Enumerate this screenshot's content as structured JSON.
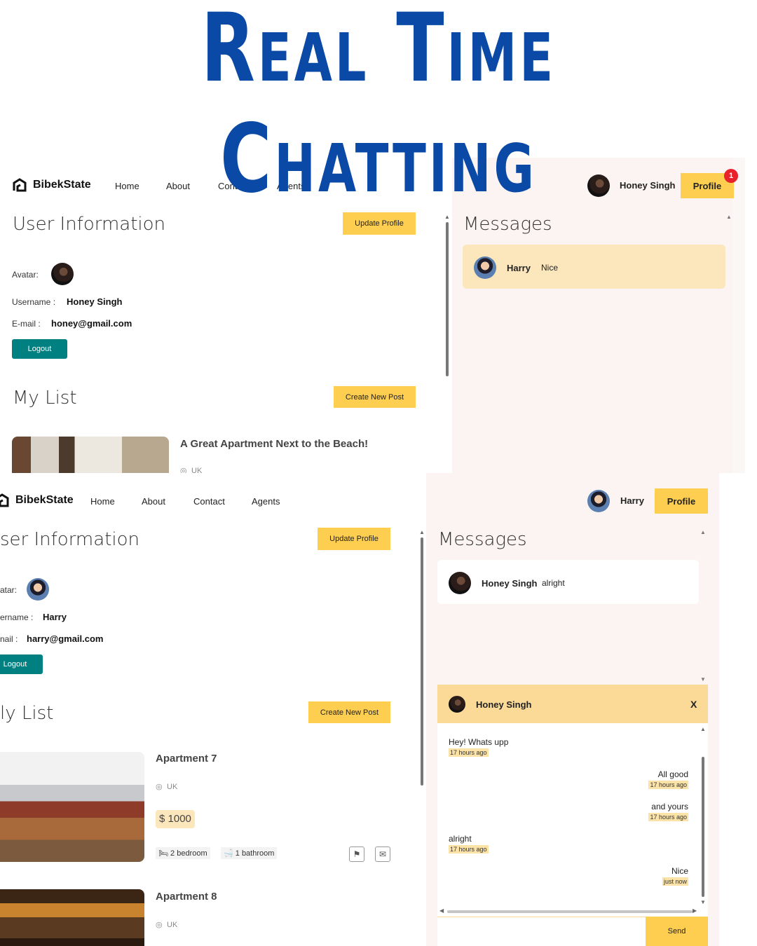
{
  "banner": {
    "line1": "Real Time",
    "line2": "Chatting"
  },
  "colors": {
    "title": "#0a49a6",
    "accent": "#fece51",
    "teal": "#008080",
    "chat_bg": "#fcf4f2"
  },
  "top": {
    "logo": "BibekState",
    "nav": [
      "Home",
      "About",
      "Contact",
      "Agents"
    ],
    "user_name": "Honey Singh",
    "profile_label": "Profile",
    "notification_count": "1",
    "section_user": "User Information",
    "update_profile": "Update Profile",
    "avatar_label": "Avatar:",
    "username_label": "Username :",
    "username": "Honey Singh",
    "email_label": "E-mail :",
    "email": "honey@gmail.com",
    "logout": "Logout",
    "section_list": "My List",
    "create_post": "Create New Post",
    "post_title": "A Great Apartment Next to the Beach!",
    "post_location": "UK",
    "messages_title": "Messages",
    "message": {
      "sender": "Harry",
      "text": "Nice"
    }
  },
  "bottom": {
    "logo": "BibekState",
    "nav": [
      "Home",
      "About",
      "Contact",
      "Agents"
    ],
    "user_name": "Harry",
    "profile_label": "Profile",
    "section_user": "ser Information",
    "update_profile": "Update Profile",
    "avatar_label": "atar:",
    "username_label": "ername :",
    "username": "Harry",
    "email_label": "nail :",
    "email": "harry@gmail.com",
    "logout": "Logout",
    "section_list": "ly List",
    "create_post": "Create New Post",
    "posts": [
      {
        "title": "Apartment 7",
        "location": "UK",
        "price": "$ 1000",
        "bedroom": "2 bedroom",
        "bathroom": "1 bathroom"
      },
      {
        "title": "Apartment 8",
        "location": "UK"
      }
    ],
    "messages_title": "Messages",
    "message": {
      "sender": "Honey Singh",
      "text": "alright"
    },
    "chat": {
      "with": "Honey Singh",
      "close": "X",
      "messages": [
        {
          "text": "Hey! Whats upp",
          "time": "17 hours ago",
          "side": "left"
        },
        {
          "text": "All good",
          "time": "17 hours ago",
          "side": "right"
        },
        {
          "text": "and yours",
          "time": "17 hours ago",
          "side": "right"
        },
        {
          "text": "alright",
          "time": "17 hours ago",
          "side": "left"
        },
        {
          "text": "Nice",
          "time": "just now",
          "side": "right"
        }
      ],
      "send": "Send"
    }
  }
}
